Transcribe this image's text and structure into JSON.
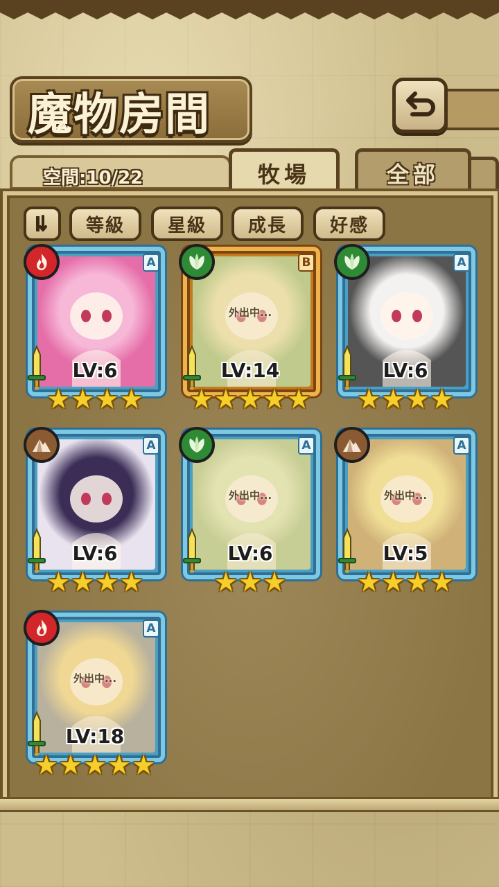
{
  "header": {
    "title": "魔物房間",
    "back_icon": "return-arrow-icon"
  },
  "tabs": {
    "space_label": "空間:10/22",
    "ranch_label": "牧場",
    "all_label": "全部"
  },
  "sort": {
    "toggle_icon": "sort-order-icon",
    "buttons": [
      "等級",
      "星級",
      "成長",
      "好感"
    ]
  },
  "monsters": [
    {
      "element": "fire",
      "rank": "A",
      "level": "LV:6",
      "stars": 4,
      "away": "",
      "palette": [
        "#f7b8d8",
        "#e56ea8"
      ]
    },
    {
      "element": "leaf",
      "rank": "B",
      "level": "LV:14",
      "stars": 5,
      "away": "外出中...",
      "palette": [
        "#e9dfa6",
        "#9bb96e"
      ]
    },
    {
      "element": "leaf",
      "rank": "A",
      "level": "LV:6",
      "stars": 4,
      "away": "",
      "palette": [
        "#f4f2f0",
        "#555555"
      ]
    },
    {
      "element": "earth",
      "rank": "A",
      "level": "LV:6",
      "stars": 4,
      "away": "",
      "palette": [
        "#3b2d56",
        "#e9e3ef"
      ]
    },
    {
      "element": "leaf",
      "rank": "A",
      "level": "LV:6",
      "stars": 3,
      "away": "外出中...",
      "palette": [
        "#d9e3b0",
        "#a7bf7c"
      ]
    },
    {
      "element": "earth",
      "rank": "A",
      "level": "LV:5",
      "stars": 4,
      "away": "外出中...",
      "palette": [
        "#f1dd7f",
        "#b78d4a"
      ]
    },
    {
      "element": "fire",
      "rank": "A",
      "level": "LV:18",
      "stars": 5,
      "away": "外出中...",
      "palette": [
        "#f0d07a",
        "#8a8a8a"
      ]
    }
  ]
}
